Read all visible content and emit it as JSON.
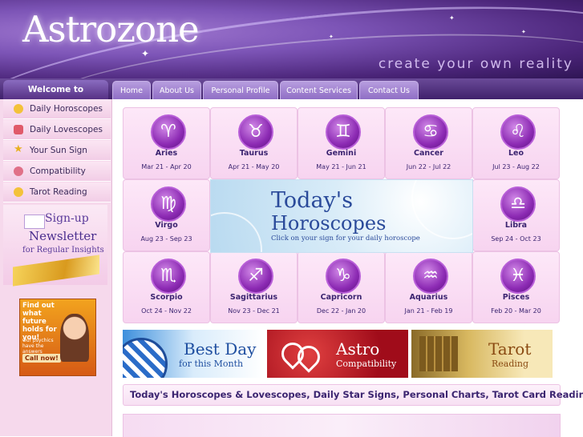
{
  "header": {
    "logo": "Astrozone",
    "tagline": "create your own reality"
  },
  "nav": {
    "welcome": "Welcome to Astrozone",
    "tabs": [
      "Home",
      "About Us",
      "Personal Profile",
      "Content Services",
      "Contact Us"
    ]
  },
  "sidebar": {
    "items": [
      {
        "label": "Daily Horoscopes",
        "icon": "sun-icon"
      },
      {
        "label": "Daily Lovescopes",
        "icon": "heart-gift-icon"
      },
      {
        "label": "Your Sun Sign",
        "icon": "star-icon"
      },
      {
        "label": "Compatibility",
        "icon": "hearts-icon"
      },
      {
        "label": "Tarot Reading",
        "icon": "sun-icon"
      }
    ],
    "newsletter": {
      "line1": "Sign-up",
      "line2": "Newsletter",
      "line3": "for Regular Insights"
    },
    "ad": {
      "headline": "Find out what future holds for you!",
      "sub": "Our psychics have the answers",
      "cta": "Call now!"
    }
  },
  "signs": [
    {
      "name": "Aries",
      "range": "Mar 21 - Apr 20",
      "glyph": "♈"
    },
    {
      "name": "Taurus",
      "range": "Apr 21 - May 20",
      "glyph": "♉"
    },
    {
      "name": "Gemini",
      "range": "May 21 - Jun 21",
      "glyph": "♊"
    },
    {
      "name": "Cancer",
      "range": "Jun 22 - Jul 22",
      "glyph": "♋"
    },
    {
      "name": "Leo",
      "range": "Jul 23 - Aug 22",
      "glyph": "♌"
    },
    {
      "name": "Virgo",
      "range": "Aug 23 - Sep 23",
      "glyph": "♍"
    },
    {
      "name": "Libra",
      "range": "Sep 24 - Oct 23",
      "glyph": "♎"
    },
    {
      "name": "Scorpio",
      "range": "Oct 24 - Nov 22",
      "glyph": "♏"
    },
    {
      "name": "Sagittarius",
      "range": "Nov 23 - Dec 21",
      "glyph": "♐"
    },
    {
      "name": "Capricorn",
      "range": "Dec 22 - Jan 20",
      "glyph": "♑"
    },
    {
      "name": "Aquarius",
      "range": "Jan 21 - Feb 19",
      "glyph": "♒"
    },
    {
      "name": "Pisces",
      "range": "Feb 20 - Mar 20",
      "glyph": "♓"
    }
  ],
  "today_banner": {
    "line1": "Today's",
    "line2": "Horoscopes",
    "sub": "Click on your sign for your daily horoscope"
  },
  "banners": {
    "best_day": {
      "title": "Best Day",
      "sub": "for this Month"
    },
    "astro": {
      "title": "Astro",
      "sub": "Compatibility"
    },
    "tarot": {
      "title": "Tarot",
      "sub": "Reading"
    }
  },
  "footer_text": "Today's Horoscopes & Lovescopes, Daily Star Signs, Personal Charts, Tarot Card Reading",
  "colors": {
    "brand_purple": "#563084",
    "sign_purple": "#8d2bb4",
    "sidebar_pink": "#f6d9ec"
  }
}
